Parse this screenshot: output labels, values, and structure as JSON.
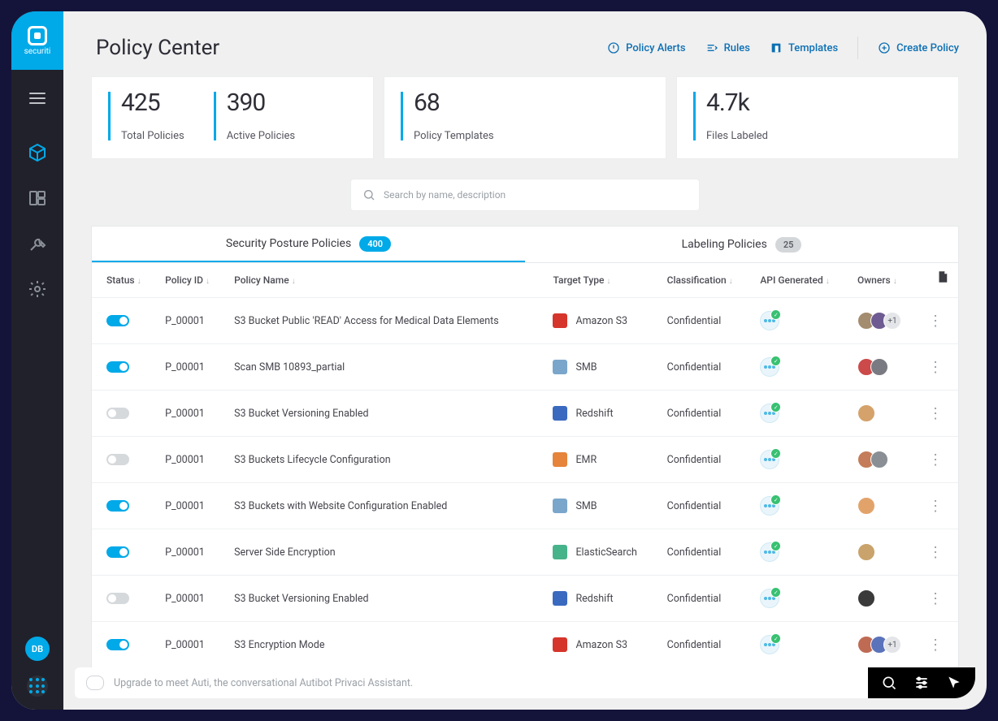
{
  "brand": "securiti",
  "page_title": "Policy Center",
  "header_links": {
    "alerts": "Policy Alerts",
    "rules": "Rules",
    "templates": "Templates",
    "create": "Create Policy"
  },
  "stats": [
    {
      "value": "425",
      "label": "Total Policies"
    },
    {
      "value": "390",
      "label": "Active Policies"
    },
    {
      "value": "68",
      "label": "Policy Templates"
    },
    {
      "value": "4.7k",
      "label": "Files Labeled"
    }
  ],
  "search_placeholder": "Search by name, description",
  "tabs": [
    {
      "label": "Security Posture Policies",
      "count": "400",
      "active": true
    },
    {
      "label": "Labeling Policies",
      "count": "25",
      "active": false
    }
  ],
  "columns": {
    "status": "Status",
    "policy_id": "Policy ID",
    "policy_name": "Policy Name",
    "target_type": "Target Type",
    "classification": "Classification",
    "api_generated": "API Generated",
    "owners": "Owners"
  },
  "rows": [
    {
      "on": true,
      "id": "P_00001",
      "name": "S3 Bucket Public 'READ' Access for Medical Data Elements",
      "target": "Amazon S3",
      "target_color": "#d6352b",
      "classification": "Confidential",
      "owners": [
        "#a38c6f",
        "#6e5b92"
      ],
      "more": "+1"
    },
    {
      "on": true,
      "id": "P_00001",
      "name": "Scan SMB 10893_partial",
      "target": "SMB",
      "target_color": "#7aa6cb",
      "classification": "Confidential",
      "owners": [
        "#cc4a4a",
        "#7a7a82"
      ],
      "more": ""
    },
    {
      "on": false,
      "id": "P_00001",
      "name": "S3 Bucket Versioning Enabled",
      "target": "Redshift",
      "target_color": "#3a6abf",
      "classification": "Confidential",
      "owners": [
        "#d4a26a"
      ],
      "more": ""
    },
    {
      "on": false,
      "id": "P_00001",
      "name": "S3 Buckets Lifecycle Configuration",
      "target": "EMR",
      "target_color": "#e5843a",
      "classification": "Confidential",
      "owners": [
        "#c47c5a",
        "#8a8f96"
      ],
      "more": ""
    },
    {
      "on": true,
      "id": "P_00001",
      "name": "S3 Buckets with Website Configuration Enabled",
      "target": "SMB",
      "target_color": "#7aa6cb",
      "classification": "Confidential",
      "owners": [
        "#e2a36b"
      ],
      "more": ""
    },
    {
      "on": true,
      "id": "P_00001",
      "name": "Server Side Encryption",
      "target": "ElasticSearch",
      "target_color": "#47b38a",
      "classification": "Confidential",
      "owners": [
        "#c9a36b"
      ],
      "more": ""
    },
    {
      "on": false,
      "id": "P_00001",
      "name": "S3 Bucket Versioning Enabled",
      "target": "Redshift",
      "target_color": "#3a6abf",
      "classification": "Confidential",
      "owners": [
        "#3a3a3a"
      ],
      "more": ""
    },
    {
      "on": true,
      "id": "P_00001",
      "name": "S3 Encryption Mode",
      "target": "Amazon S3",
      "target_color": "#d6352b",
      "classification": "Confidential",
      "owners": [
        "#bf6b54",
        "#5b73bb"
      ],
      "more": "+1"
    }
  ],
  "footer_message": "Upgrade to meet Auti, the conversational Autibot Privaci Assistant.",
  "user_initials": "DB"
}
